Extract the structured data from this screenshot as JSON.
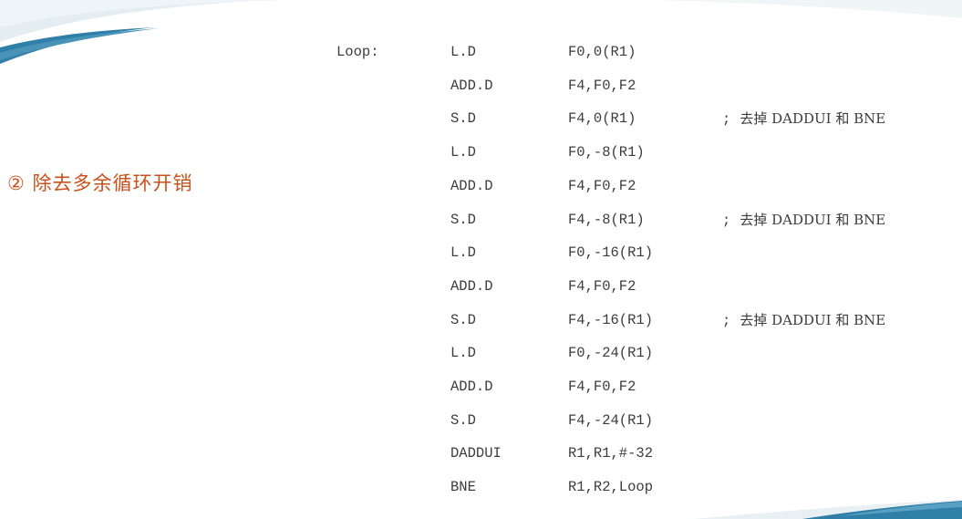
{
  "heading": "② 除去多余循环开销",
  "code": [
    {
      "label": "Loop:",
      "op": "L.D",
      "args": "F0,0(R1)",
      "comment": ""
    },
    {
      "label": "",
      "op": "ADD.D",
      "args": "F4,F0,F2",
      "comment": ""
    },
    {
      "label": "",
      "op": "S.D",
      "args": "F4,0(R1)",
      "comment": "去掉 DADDUI 和 BNE"
    },
    {
      "label": "",
      "op": "L.D",
      "args": "F0,-8(R1)",
      "comment": ""
    },
    {
      "label": "",
      "op": "ADD.D",
      "args": "F4,F0,F2",
      "comment": ""
    },
    {
      "label": "",
      "op": "S.D",
      "args": "F4,-8(R1)",
      "comment": "去掉 DADDUI 和 BNE"
    },
    {
      "label": "",
      "op": "L.D",
      "args": "F0,-16(R1)",
      "comment": ""
    },
    {
      "label": "",
      "op": "ADD.D",
      "args": "F4,F0,F2",
      "comment": ""
    },
    {
      "label": "",
      "op": "S.D",
      "args": "F4,-16(R1)",
      "comment": "去掉 DADDUI 和 BNE"
    },
    {
      "label": "",
      "op": "L.D",
      "args": "F0,-24(R1)",
      "comment": ""
    },
    {
      "label": "",
      "op": "ADD.D",
      "args": "F4,F0,F2",
      "comment": ""
    },
    {
      "label": "",
      "op": "S.D",
      "args": "F4,-24(R1)",
      "comment": ""
    },
    {
      "label": "",
      "op": "DADDUI",
      "args": "R1,R1,#-32",
      "comment": ""
    },
    {
      "label": "",
      "op": "BNE",
      "args": "R1,R2,Loop",
      "comment": ""
    }
  ],
  "colors": {
    "heading": "#c8511b",
    "code_text": "#3c3c3c",
    "accent_blue": "#2f7fa8",
    "accent_light": "#c9dce6"
  }
}
